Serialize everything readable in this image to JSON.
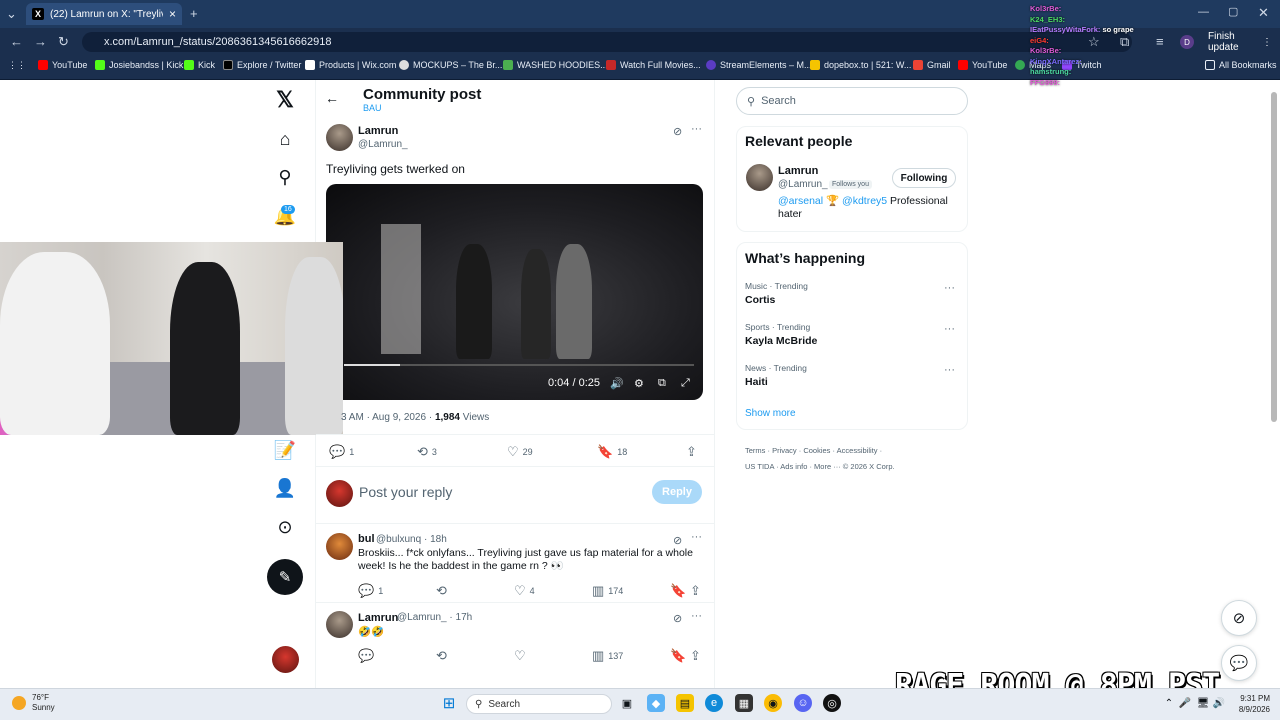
{
  "browser": {
    "tab_title": "(22) Lamrun on X: \"Treyliving ge",
    "url": "x.com/Lamrun_/status/2086361345616662918",
    "finish_update": "Finish update",
    "profile_initial": "D",
    "bookmarks": [
      "YouTube",
      "Josiebandss | Kick",
      "Kick",
      "Explore / Twitter",
      "Products | Wix.com",
      "MOCKUPS – The Br...",
      "WASHED HOODIES...",
      "Watch Full Movies...",
      "StreamElements – M...",
      "dopebox.to | 521: W...",
      "Gmail",
      "YouTube",
      "Maps",
      "Twitch"
    ],
    "all_bookmarks": "All Bookmarks"
  },
  "chat": [
    {
      "user": "Kol3rBe:",
      "msg": ""
    },
    {
      "user": "K24_EH3:",
      "msg": ""
    },
    {
      "user": "IEatPussyWitaFork:",
      "msg": "so grape"
    },
    {
      "user": "eiG4:",
      "msg": ""
    },
    {
      "user": "Kol3rBe:",
      "msg": ""
    },
    {
      "user": "KingXAntarez:",
      "msg": ""
    },
    {
      "user": "hamstrung:",
      "msg": ""
    },
    {
      "user": "FFG999:",
      "msg": ""
    }
  ],
  "nav": {
    "notification_count": "16"
  },
  "post": {
    "header_title": "Community post",
    "header_sub": "BAU",
    "author_name": "Lamrun",
    "author_handle": "@Lamrun_",
    "text": "Treyliving gets twerked on",
    "video_time": "0:04 / 0:25",
    "timestamp": "3 AM · Aug 9, 2026 · ",
    "views_count": "1,984",
    "views_label": " Views",
    "replies": "1",
    "reposts": "3",
    "likes": "29",
    "bookmarks": "18",
    "reply_placeholder": "Post your reply",
    "reply_button": "Reply"
  },
  "replies": [
    {
      "name": "bul",
      "handle_time": "@bulxunq · 18h",
      "text": "Broskiis... f*ck onlyfans... Treyliving just gave us fap material for a whole week! Is he the baddest in the game rn ? 👀",
      "replies": "1",
      "likes": "4",
      "views": "174"
    },
    {
      "name": "Lamrun",
      "handle_time": "@Lamrun_ · 17h",
      "text": "🤣🤣",
      "views": "137"
    }
  ],
  "sidebar": {
    "search_placeholder": "Search",
    "relevant_title": "Relevant people",
    "person_name": "Lamrun",
    "person_handle": "@Lamrun_",
    "follows_you": "Follows you",
    "following_btn": "Following",
    "bio_link1": "@arsenal",
    "bio_link2": "@kdtrey5",
    "bio_rest": " Professional hater",
    "happening_title": "What’s happening",
    "trends": [
      {
        "category": "Music · Trending",
        "name": "Cortis"
      },
      {
        "category": "Sports · Trending",
        "name": "Kayla McBride"
      },
      {
        "category": "News · Trending",
        "name": "Haiti"
      }
    ],
    "show_more": "Show more",
    "footer_line1": "Terms · Privacy · Cookies · Accessibility ·",
    "footer_line2": "US TIDA · Ads info · More ··· © 2026 X Corp."
  },
  "overlay": {
    "stream_text": "RAGE ROOM @ 8PM PST"
  },
  "taskbar": {
    "temperature": "76°F",
    "condition": "Sunny",
    "search": "Search",
    "time": "9:31 PM",
    "date": "8/9/2026"
  }
}
